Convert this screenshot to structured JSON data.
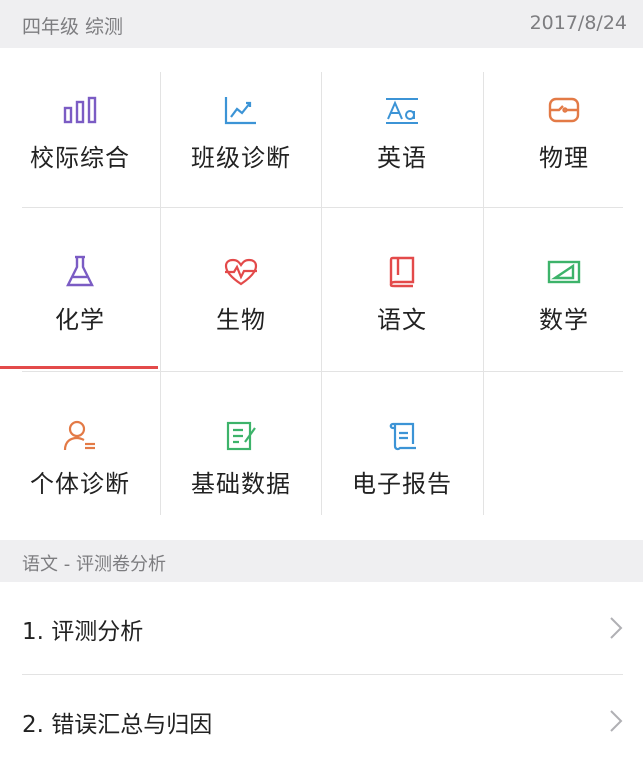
{
  "header": {
    "title": "四年级 综测",
    "date": "2017/8/24"
  },
  "grid": {
    "items": [
      {
        "label": "校际综合",
        "icon": "bar-chart-icon",
        "color": "#7b5cc4"
      },
      {
        "label": "班级诊断",
        "icon": "line-chart-icon",
        "color": "#3c94d6"
      },
      {
        "label": "英语",
        "icon": "text-aa-icon",
        "color": "#3c94d6"
      },
      {
        "label": "物理",
        "icon": "circuit-icon",
        "color": "#e37a46"
      },
      {
        "label": "化学",
        "icon": "flask-icon",
        "color": "#7b5cc4"
      },
      {
        "label": "生物",
        "icon": "heartbeat-icon",
        "color": "#e34a4a"
      },
      {
        "label": "语文",
        "icon": "book-icon",
        "color": "#e34a4a"
      },
      {
        "label": "数学",
        "icon": "ruler-triangle-icon",
        "color": "#3db36a"
      },
      {
        "label": "个体诊断",
        "icon": "person-icon",
        "color": "#e37a46"
      },
      {
        "label": "基础数据",
        "icon": "document-edit-icon",
        "color": "#3db36a"
      },
      {
        "label": "电子报告",
        "icon": "scroll-icon",
        "color": "#3c94d6"
      }
    ],
    "active_item": "化学"
  },
  "section": {
    "title": "语文 - 评测卷分析"
  },
  "list": {
    "items": [
      {
        "label": "1. 评测分析"
      },
      {
        "label": "2. 错误汇总与归因"
      }
    ]
  }
}
